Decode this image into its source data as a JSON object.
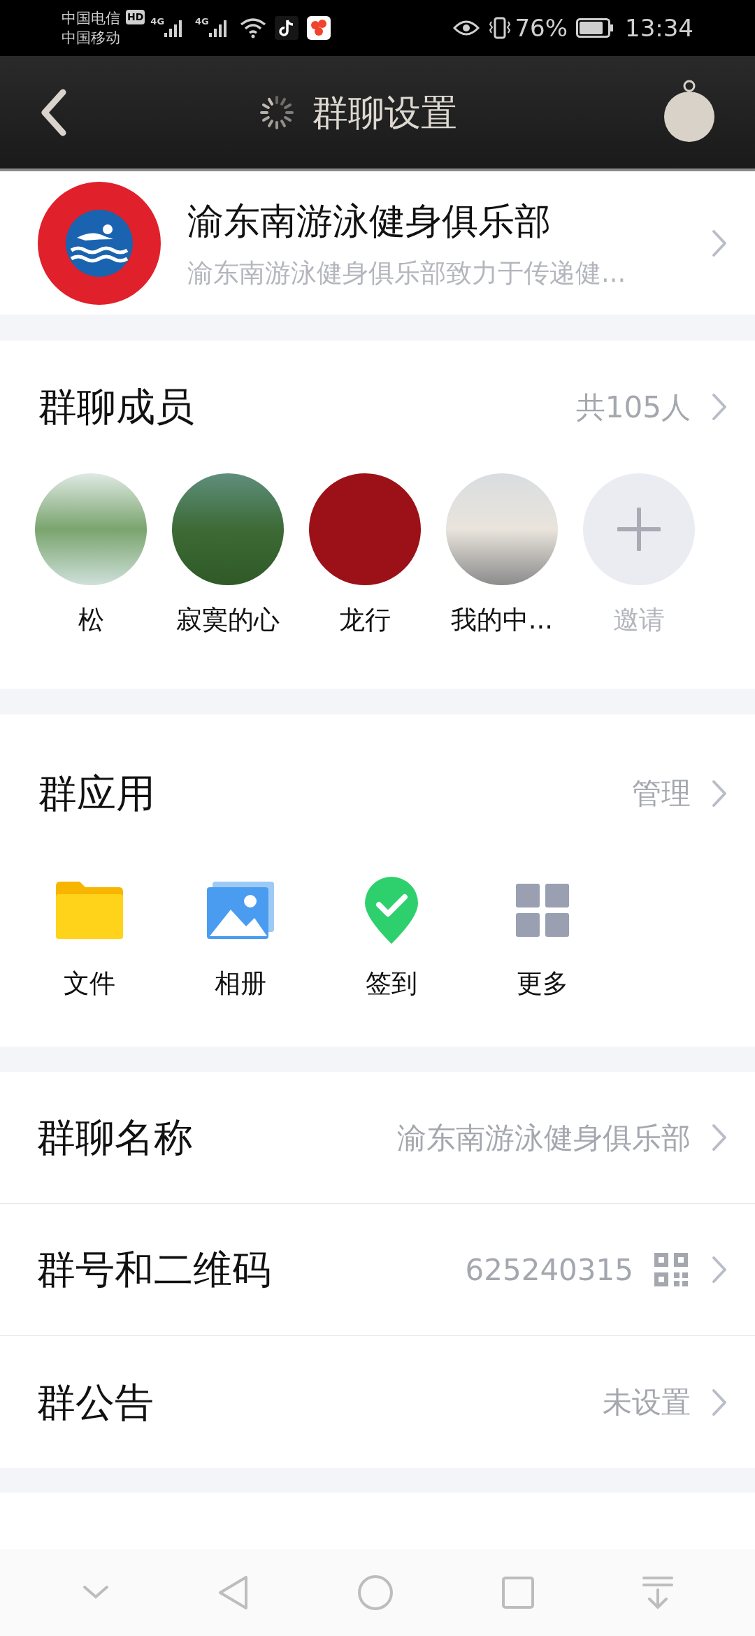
{
  "status_bar": {
    "carriers": [
      "中国电信",
      "中国移动"
    ],
    "hd": "HD",
    "networks": [
      "4G",
      "4G"
    ],
    "battery": "76%",
    "time": "13:34"
  },
  "header": {
    "title": "群聊设置"
  },
  "group": {
    "name": "渝东南游泳健身俱乐部",
    "description": "渝东南游泳健身俱乐部致力于传递健..."
  },
  "members": {
    "title": "群聊成员",
    "count": "共105人",
    "list": [
      {
        "name": "松"
      },
      {
        "name": "寂寞的心"
      },
      {
        "name": "龙行"
      },
      {
        "name": "我的中..."
      }
    ],
    "invite": "邀请"
  },
  "apps": {
    "title": "群应用",
    "action": "管理",
    "items": [
      {
        "label": "文件",
        "kind": "folder"
      },
      {
        "label": "相册",
        "kind": "album"
      },
      {
        "label": "签到",
        "kind": "checkin"
      },
      {
        "label": "更多",
        "kind": "more"
      }
    ]
  },
  "settings": [
    {
      "label": "群聊名称",
      "value": "渝东南游泳健身俱乐部",
      "kind": "text"
    },
    {
      "label": "群号和二维码",
      "value": "625240315",
      "kind": "qr"
    },
    {
      "label": "群公告",
      "value": "未设置",
      "kind": "text"
    }
  ]
}
